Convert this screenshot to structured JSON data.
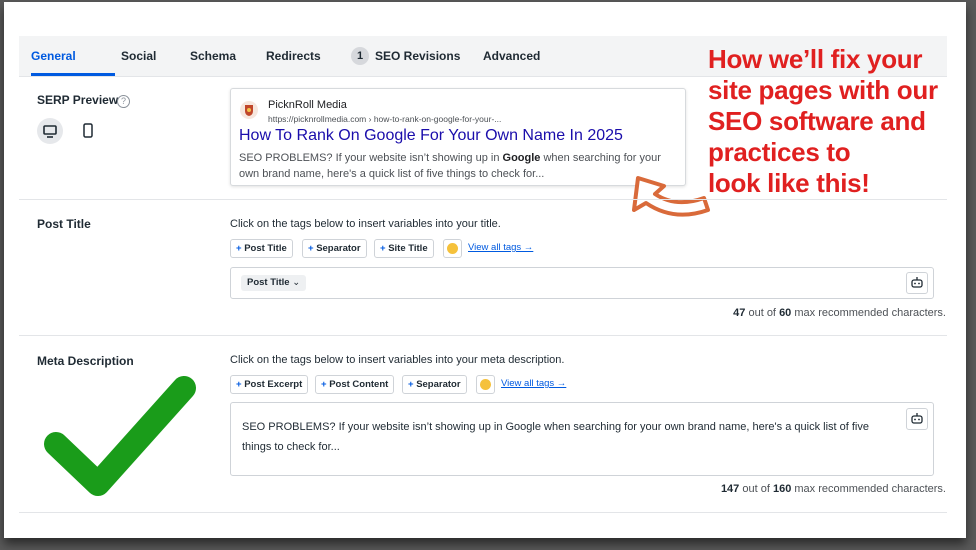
{
  "tabs": [
    {
      "label": "General"
    },
    {
      "label": "Social"
    },
    {
      "label": "Schema"
    },
    {
      "label": "Redirects"
    },
    {
      "label": "SEO Revisions",
      "badge": "1"
    },
    {
      "label": "Advanced"
    }
  ],
  "serp_section": {
    "label": "SERP Preview",
    "help_icon": "?",
    "preview": {
      "site_name": "PicknRoll Media",
      "url": "https://picknrollmedia.com › how-to-rank-on-google-for-your-...",
      "title": "How To Rank On Google For Your Own Name In 2025",
      "desc_before": "SEO PROBLEMS? If your website isn’t showing up in ",
      "desc_bold": "Google",
      "desc_after": " when searching for your own brand name, here's a quick list of five things to check for..."
    }
  },
  "post_title": {
    "label": "Post Title",
    "instruction": "Click on the tags below to insert variables into your title.",
    "tags": [
      "Post Title",
      "Separator",
      "Site Title"
    ],
    "view_all": "View all tags →",
    "chip": "Post Title",
    "count": "47",
    "max": "60",
    "count_text": "max recommended characters.",
    "out_of": "out of"
  },
  "meta": {
    "label": "Meta Description",
    "instruction": "Click on the tags below to insert variables into your meta description.",
    "tags": [
      "Post Excerpt",
      "Post Content",
      "Separator"
    ],
    "view_all": "View all tags →",
    "value": "SEO PROBLEMS? If your website isn’t showing up in Google when searching for your own brand name, here's a quick list of five things to check for...",
    "count": "147",
    "max": "160",
    "count_text": "max recommended characters.",
    "out_of": "out of"
  },
  "callout": {
    "line1": "How we’ll fix your",
    "line2": "site pages with our",
    "line3": "SEO software and",
    "line4": "practices to",
    "line5": "look like this!"
  },
  "colors": {
    "accent": "#005ae0",
    "callout": "#e02020",
    "check": "#1a9c1a",
    "arrow": "#d96a3a"
  }
}
